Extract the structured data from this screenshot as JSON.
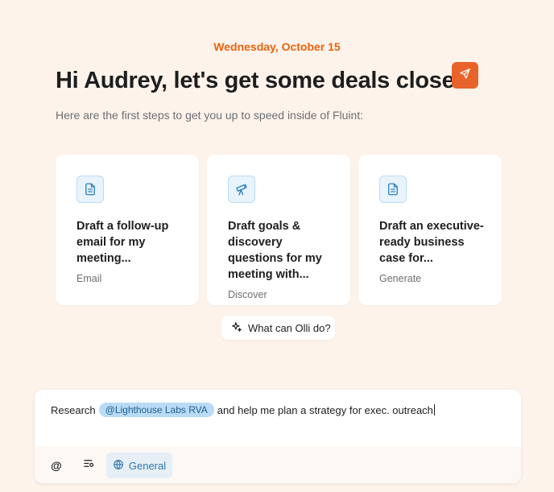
{
  "header": {
    "date": "Wednesday, October 15",
    "greeting": "Hi Audrey, let's get some deals closed",
    "subtitle": "Here are the first steps to get you up to speed inside of Fluint:"
  },
  "cards": [
    {
      "title": "Draft a follow-up email for my meeting...",
      "tag": "Email",
      "icon": "document-icon"
    },
    {
      "title": "Draft goals & discovery questions for my meeting with...",
      "tag": "Discover",
      "icon": "telescope-icon"
    },
    {
      "title": "Draft an executive-ready business case for...",
      "tag": "Generate",
      "icon": "document-icon"
    }
  ],
  "olli_button": {
    "label": "What can Olli do?",
    "icon": "sparkle-icon"
  },
  "composer": {
    "prefix": "Research",
    "mention": "@Lighthouse Labs RVA",
    "suffix": "and help me plan a strategy for exec. outreach",
    "at_symbol": "@",
    "mode_label": "General",
    "send_icon": "send-icon"
  },
  "colors": {
    "background": "#fdf3ea",
    "accent": "#e8640f",
    "send": "#e8632a",
    "mention_bg": "#b9dbf5"
  }
}
